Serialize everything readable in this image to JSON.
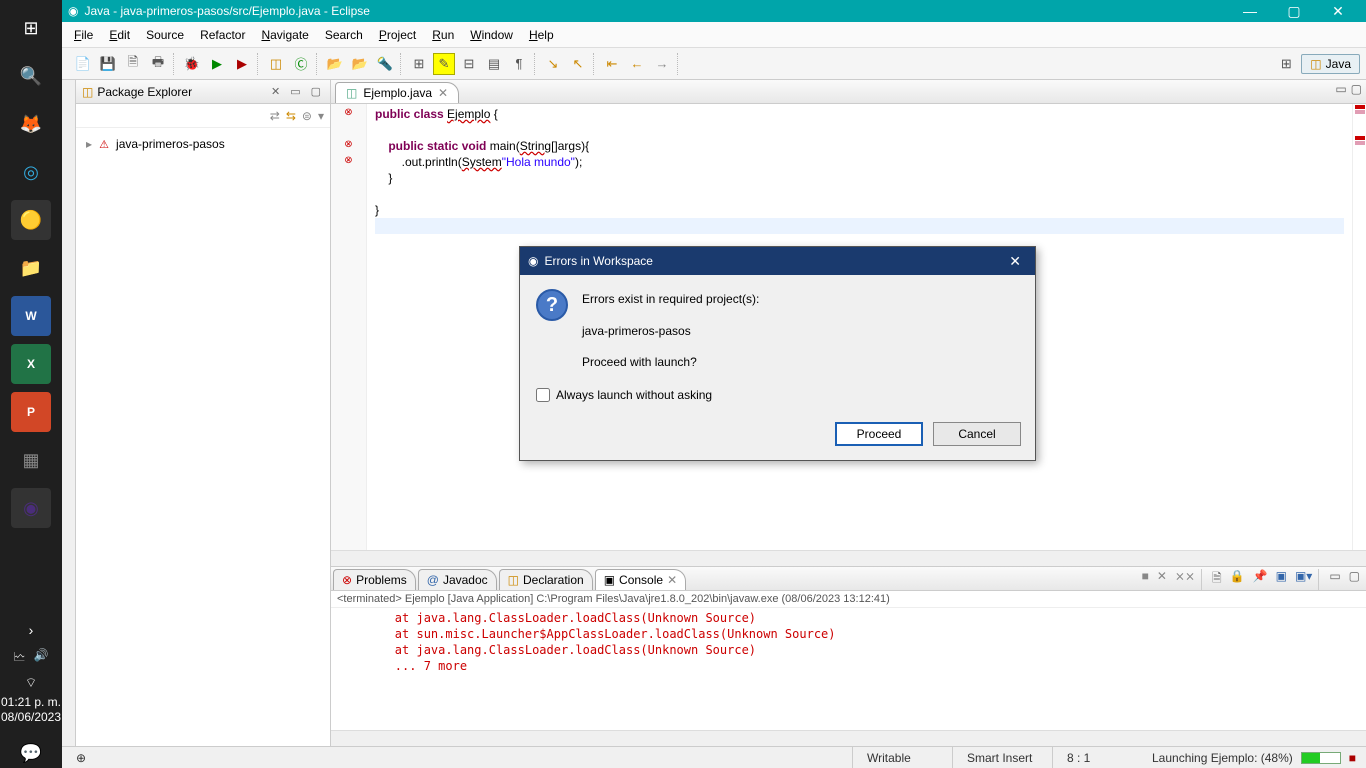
{
  "titlebar": {
    "text": "Java - java-primeros-pasos/src/Ejemplo.java - Eclipse"
  },
  "menu": {
    "file": "File",
    "edit": "Edit",
    "source": "Source",
    "refactor": "Refactor",
    "navigate": "Navigate",
    "search": "Search",
    "project": "Project",
    "run": "Run",
    "window": "Window",
    "help": "Help"
  },
  "perspective": {
    "label": "Java"
  },
  "package_explorer": {
    "title": "Package Explorer",
    "items": [
      {
        "label": "java-primeros-pasos"
      }
    ]
  },
  "editor": {
    "tab": "Ejemplo.java",
    "code_lines": [
      {
        "pre": "",
        "kw": "public class",
        "mid": " ",
        "err": "Ejemplo",
        "post": " {"
      },
      {
        "pre": ""
      },
      {
        "pre": "    ",
        "kw": "public static void",
        "mid": " main(",
        "err": "String",
        "post": "[]args){"
      },
      {
        "pre": "        ",
        "err": "System",
        "mid": ".out.println(",
        "str": "\"Hola mundo\"",
        "post": ");"
      },
      {
        "pre": "    }"
      },
      {
        "pre": ""
      },
      {
        "pre": "}"
      },
      {
        "pre": "",
        "cursor": true
      }
    ]
  },
  "bottom_tabs": {
    "problems": "Problems",
    "javadoc": "Javadoc",
    "declaration": "Declaration",
    "console": "Console"
  },
  "console": {
    "header": "<terminated> Ejemplo [Java Application] C:\\Program Files\\Java\\jre1.8.0_202\\bin\\javaw.exe (08/06/2023 13:12:41)",
    "lines": [
      "        at java.lang.ClassLoader.loadClass(Unknown Source)",
      "        at sun.misc.Launcher$AppClassLoader.loadClass(Unknown Source)",
      "        at java.lang.ClassLoader.loadClass(Unknown Source)",
      "        ... 7 more"
    ]
  },
  "status": {
    "writable": "Writable",
    "insert": "Smart Insert",
    "pos": "8 : 1",
    "launch": "Launching Ejemplo: (48%)"
  },
  "dialog": {
    "title": "Errors in Workspace",
    "line1": "Errors exist in required project(s):",
    "line2": "java-primeros-pasos",
    "line3": "Proceed with launch?",
    "checkbox": "Always launch without asking",
    "proceed": "Proceed",
    "cancel": "Cancel"
  },
  "taskbar": {
    "time": "01:21 p. m.",
    "date": "08/06/2023"
  }
}
